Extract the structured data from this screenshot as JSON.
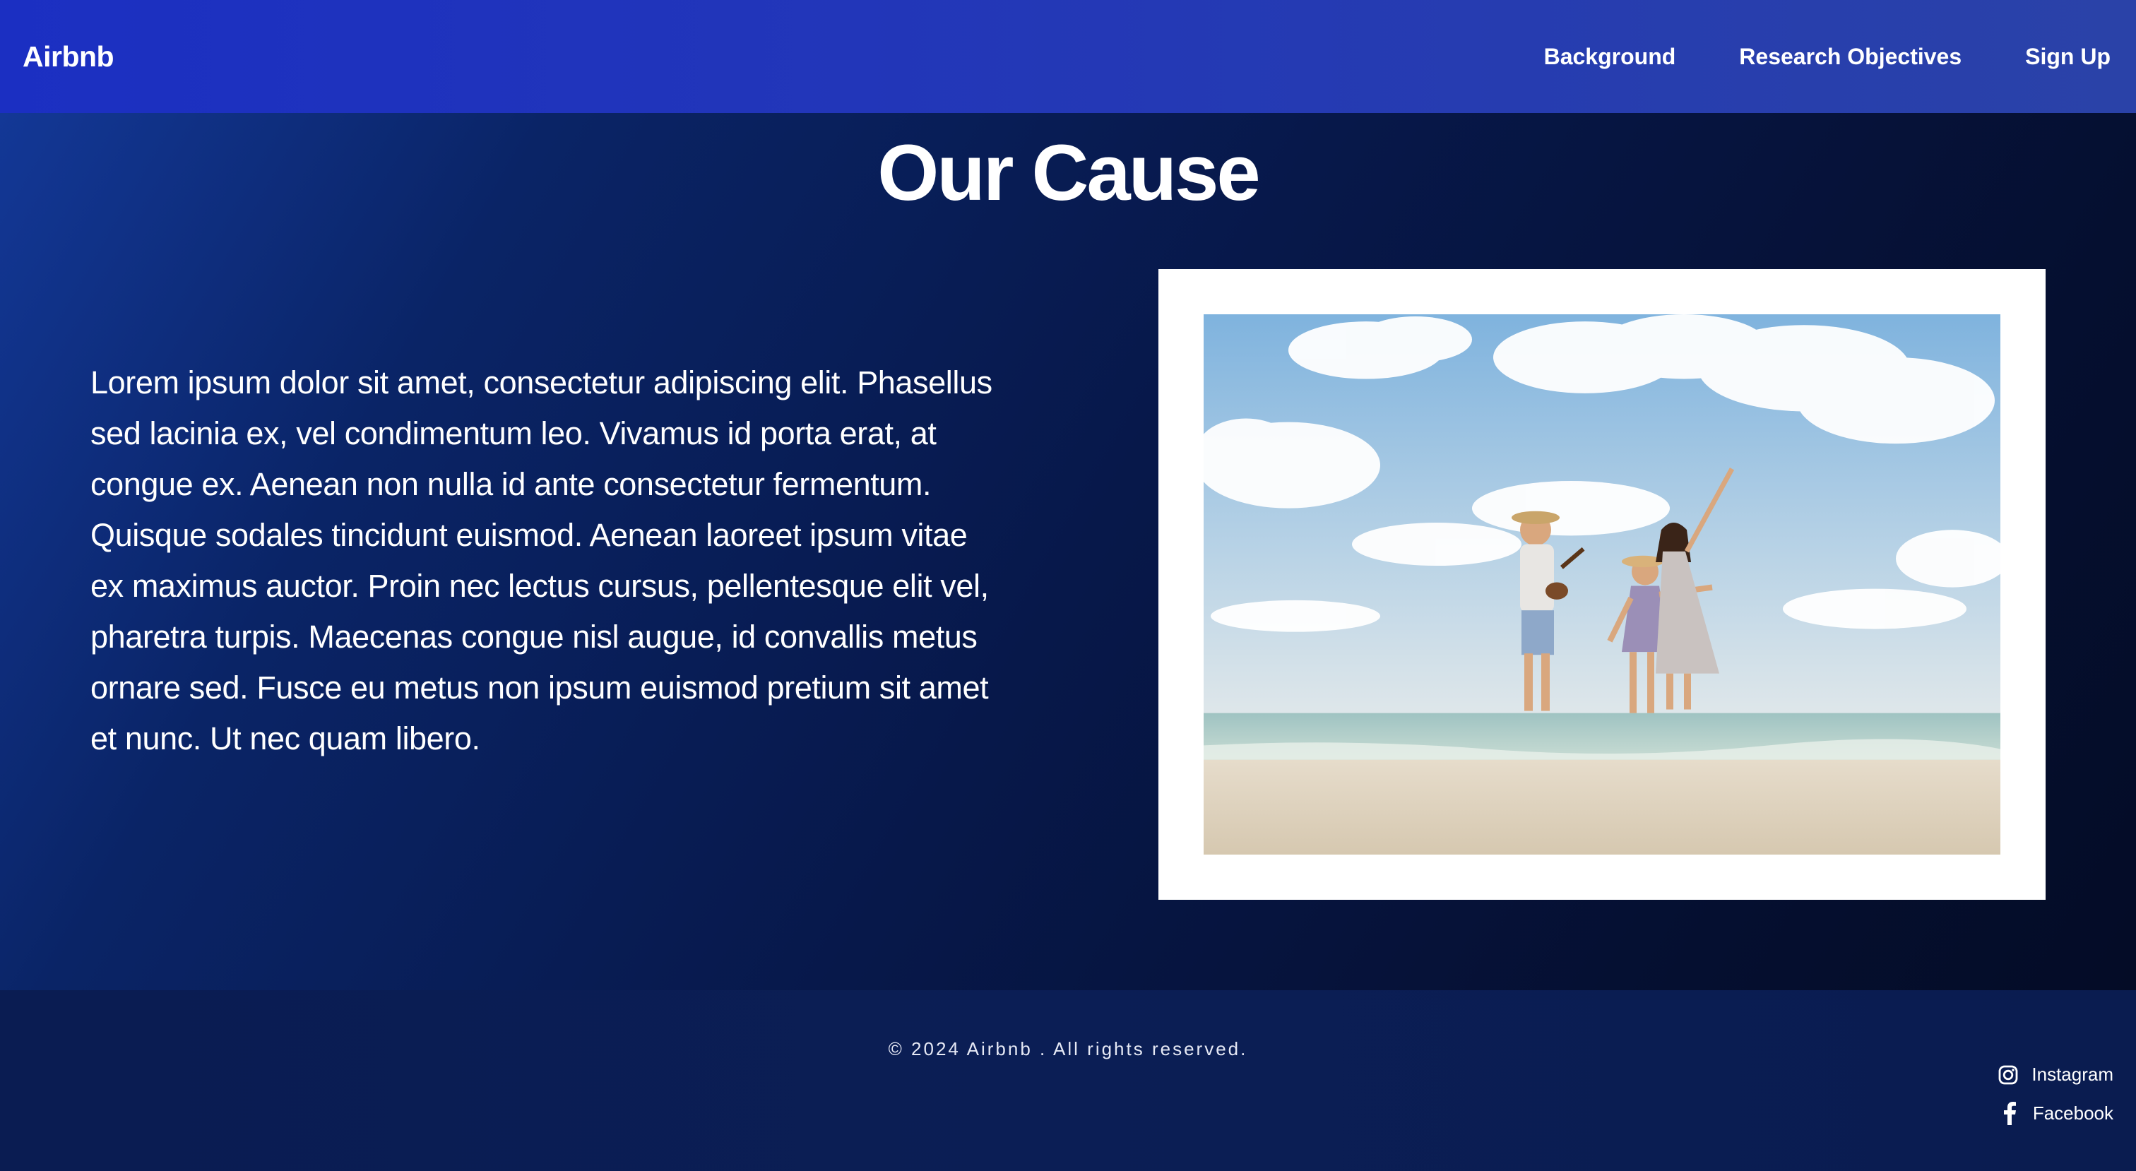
{
  "navbar": {
    "brand": "Airbnb",
    "links": [
      {
        "label": "Background"
      },
      {
        "label": "Research Objectives"
      },
      {
        "label": "Sign Up"
      }
    ]
  },
  "main": {
    "title": "Our Cause",
    "paragraph": "Lorem ipsum dolor sit amet, consectetur adipiscing elit. Phasellus sed lacinia ex, vel condimentum leo. Vivamus id porta erat, at congue ex. Aenean non nulla id ante consectetur fermentum. Quisque sodales tincidunt euismod. Aenean laoreet ipsum vitae ex maximus auctor. Proin nec lectus cursus, pellentesque elit vel, pharetra turpis. Maecenas congue nisl augue, id convallis metus ornare sed. Fusce eu metus non ipsum euismod pretium sit amet et nunc. Ut nec quam libero.",
    "image": {
      "subject": "family-on-beach-photo"
    }
  },
  "footer": {
    "copyright": "© 2024 Airbnb . All rights reserved.",
    "social": [
      {
        "label": "Instagram",
        "icon": "instagram-icon"
      },
      {
        "label": "Facebook",
        "icon": "facebook-icon"
      }
    ]
  },
  "colors": {
    "navbar": "#1b2fc2",
    "background": "#07184a",
    "footer": "#0a1c52",
    "text": "#ffffff"
  }
}
